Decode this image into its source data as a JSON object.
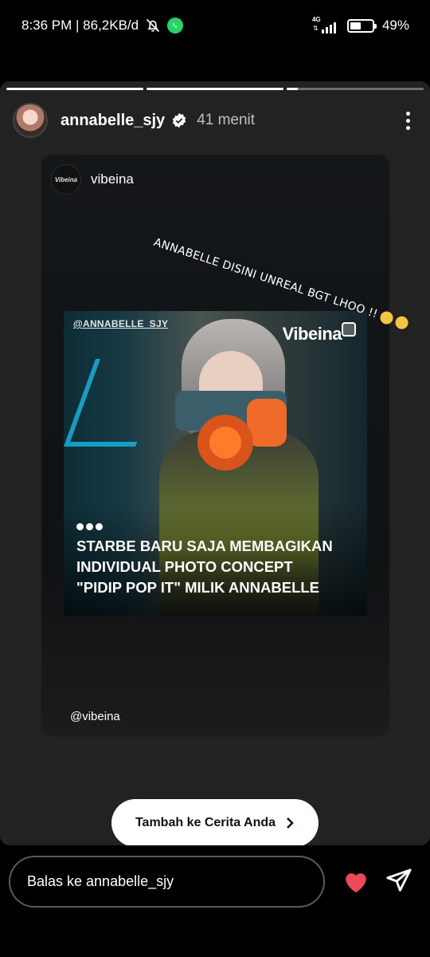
{
  "status_bar": {
    "time_speed": "8:36 PM | 86,2KB/d",
    "network": "4G",
    "battery": "49%",
    "battery_level": 0.49
  },
  "story": {
    "progress_segments": [
      1,
      1,
      0.08
    ],
    "username": "annabelle_sjy",
    "time_ago": "41 menit",
    "icons": {
      "verified": "verified-badge-icon",
      "more": "more-options-icon"
    }
  },
  "shared_post": {
    "author": "vibeina",
    "author_avatar_text": "Vibeina",
    "annotation": "ANNABELLE DISINI UNREAL BGT LHOO !!",
    "image": {
      "handle": "@ANNABELLE_SJY",
      "brand": "Vibeina",
      "caption_lines": [
        "STARBE BARU SAJA MEMBAGIKAN",
        "INDIVIDUAL PHOTO CONCEPT",
        "\"PIDIP POP IT\" MILIK ANNABELLE"
      ]
    },
    "mention": "@vibeina"
  },
  "add_to_story": {
    "label": "Tambah ke Cerita Anda"
  },
  "reply": {
    "placeholder": "Balas ke annabelle_sjy",
    "colors": {
      "like": "#ED4956"
    }
  }
}
